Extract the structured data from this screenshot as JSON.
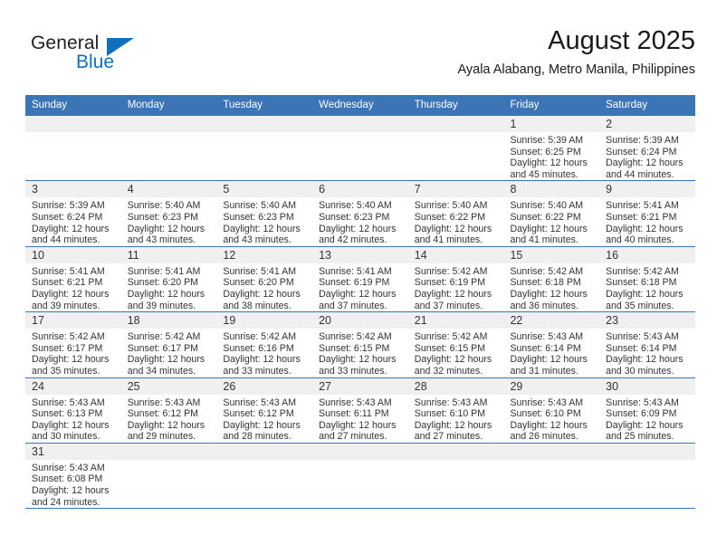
{
  "brand": {
    "name_part1": "General",
    "name_part2": "Blue",
    "logo_icon": "triangle-logo-icon",
    "accent_color": "#1070bb"
  },
  "header": {
    "month_title": "August 2025",
    "location": "Ayala Alabang, Metro Manila, Philippines"
  },
  "theme": {
    "header_blue": "#3b75b5",
    "band_gray": "#f0f0f0",
    "text_color": "#333333"
  },
  "weekday_headers": [
    "Sunday",
    "Monday",
    "Tuesday",
    "Wednesday",
    "Thursday",
    "Friday",
    "Saturday"
  ],
  "weeks": [
    [
      {
        "day": "",
        "sunrise": "",
        "sunset": "",
        "daylight1": "",
        "daylight2": ""
      },
      {
        "day": "",
        "sunrise": "",
        "sunset": "",
        "daylight1": "",
        "daylight2": ""
      },
      {
        "day": "",
        "sunrise": "",
        "sunset": "",
        "daylight1": "",
        "daylight2": ""
      },
      {
        "day": "",
        "sunrise": "",
        "sunset": "",
        "daylight1": "",
        "daylight2": ""
      },
      {
        "day": "",
        "sunrise": "",
        "sunset": "",
        "daylight1": "",
        "daylight2": ""
      },
      {
        "day": "1",
        "sunrise": "Sunrise: 5:39 AM",
        "sunset": "Sunset: 6:25 PM",
        "daylight1": "Daylight: 12 hours",
        "daylight2": "and 45 minutes."
      },
      {
        "day": "2",
        "sunrise": "Sunrise: 5:39 AM",
        "sunset": "Sunset: 6:24 PM",
        "daylight1": "Daylight: 12 hours",
        "daylight2": "and 44 minutes."
      }
    ],
    [
      {
        "day": "3",
        "sunrise": "Sunrise: 5:39 AM",
        "sunset": "Sunset: 6:24 PM",
        "daylight1": "Daylight: 12 hours",
        "daylight2": "and 44 minutes."
      },
      {
        "day": "4",
        "sunrise": "Sunrise: 5:40 AM",
        "sunset": "Sunset: 6:23 PM",
        "daylight1": "Daylight: 12 hours",
        "daylight2": "and 43 minutes."
      },
      {
        "day": "5",
        "sunrise": "Sunrise: 5:40 AM",
        "sunset": "Sunset: 6:23 PM",
        "daylight1": "Daylight: 12 hours",
        "daylight2": "and 43 minutes."
      },
      {
        "day": "6",
        "sunrise": "Sunrise: 5:40 AM",
        "sunset": "Sunset: 6:23 PM",
        "daylight1": "Daylight: 12 hours",
        "daylight2": "and 42 minutes."
      },
      {
        "day": "7",
        "sunrise": "Sunrise: 5:40 AM",
        "sunset": "Sunset: 6:22 PM",
        "daylight1": "Daylight: 12 hours",
        "daylight2": "and 41 minutes."
      },
      {
        "day": "8",
        "sunrise": "Sunrise: 5:40 AM",
        "sunset": "Sunset: 6:22 PM",
        "daylight1": "Daylight: 12 hours",
        "daylight2": "and 41 minutes."
      },
      {
        "day": "9",
        "sunrise": "Sunrise: 5:41 AM",
        "sunset": "Sunset: 6:21 PM",
        "daylight1": "Daylight: 12 hours",
        "daylight2": "and 40 minutes."
      }
    ],
    [
      {
        "day": "10",
        "sunrise": "Sunrise: 5:41 AM",
        "sunset": "Sunset: 6:21 PM",
        "daylight1": "Daylight: 12 hours",
        "daylight2": "and 39 minutes."
      },
      {
        "day": "11",
        "sunrise": "Sunrise: 5:41 AM",
        "sunset": "Sunset: 6:20 PM",
        "daylight1": "Daylight: 12 hours",
        "daylight2": "and 39 minutes."
      },
      {
        "day": "12",
        "sunrise": "Sunrise: 5:41 AM",
        "sunset": "Sunset: 6:20 PM",
        "daylight1": "Daylight: 12 hours",
        "daylight2": "and 38 minutes."
      },
      {
        "day": "13",
        "sunrise": "Sunrise: 5:41 AM",
        "sunset": "Sunset: 6:19 PM",
        "daylight1": "Daylight: 12 hours",
        "daylight2": "and 37 minutes."
      },
      {
        "day": "14",
        "sunrise": "Sunrise: 5:42 AM",
        "sunset": "Sunset: 6:19 PM",
        "daylight1": "Daylight: 12 hours",
        "daylight2": "and 37 minutes."
      },
      {
        "day": "15",
        "sunrise": "Sunrise: 5:42 AM",
        "sunset": "Sunset: 6:18 PM",
        "daylight1": "Daylight: 12 hours",
        "daylight2": "and 36 minutes."
      },
      {
        "day": "16",
        "sunrise": "Sunrise: 5:42 AM",
        "sunset": "Sunset: 6:18 PM",
        "daylight1": "Daylight: 12 hours",
        "daylight2": "and 35 minutes."
      }
    ],
    [
      {
        "day": "17",
        "sunrise": "Sunrise: 5:42 AM",
        "sunset": "Sunset: 6:17 PM",
        "daylight1": "Daylight: 12 hours",
        "daylight2": "and 35 minutes."
      },
      {
        "day": "18",
        "sunrise": "Sunrise: 5:42 AM",
        "sunset": "Sunset: 6:17 PM",
        "daylight1": "Daylight: 12 hours",
        "daylight2": "and 34 minutes."
      },
      {
        "day": "19",
        "sunrise": "Sunrise: 5:42 AM",
        "sunset": "Sunset: 6:16 PM",
        "daylight1": "Daylight: 12 hours",
        "daylight2": "and 33 minutes."
      },
      {
        "day": "20",
        "sunrise": "Sunrise: 5:42 AM",
        "sunset": "Sunset: 6:15 PM",
        "daylight1": "Daylight: 12 hours",
        "daylight2": "and 33 minutes."
      },
      {
        "day": "21",
        "sunrise": "Sunrise: 5:42 AM",
        "sunset": "Sunset: 6:15 PM",
        "daylight1": "Daylight: 12 hours",
        "daylight2": "and 32 minutes."
      },
      {
        "day": "22",
        "sunrise": "Sunrise: 5:43 AM",
        "sunset": "Sunset: 6:14 PM",
        "daylight1": "Daylight: 12 hours",
        "daylight2": "and 31 minutes."
      },
      {
        "day": "23",
        "sunrise": "Sunrise: 5:43 AM",
        "sunset": "Sunset: 6:14 PM",
        "daylight1": "Daylight: 12 hours",
        "daylight2": "and 30 minutes."
      }
    ],
    [
      {
        "day": "24",
        "sunrise": "Sunrise: 5:43 AM",
        "sunset": "Sunset: 6:13 PM",
        "daylight1": "Daylight: 12 hours",
        "daylight2": "and 30 minutes."
      },
      {
        "day": "25",
        "sunrise": "Sunrise: 5:43 AM",
        "sunset": "Sunset: 6:12 PM",
        "daylight1": "Daylight: 12 hours",
        "daylight2": "and 29 minutes."
      },
      {
        "day": "26",
        "sunrise": "Sunrise: 5:43 AM",
        "sunset": "Sunset: 6:12 PM",
        "daylight1": "Daylight: 12 hours",
        "daylight2": "and 28 minutes."
      },
      {
        "day": "27",
        "sunrise": "Sunrise: 5:43 AM",
        "sunset": "Sunset: 6:11 PM",
        "daylight1": "Daylight: 12 hours",
        "daylight2": "and 27 minutes."
      },
      {
        "day": "28",
        "sunrise": "Sunrise: 5:43 AM",
        "sunset": "Sunset: 6:10 PM",
        "daylight1": "Daylight: 12 hours",
        "daylight2": "and 27 minutes."
      },
      {
        "day": "29",
        "sunrise": "Sunrise: 5:43 AM",
        "sunset": "Sunset: 6:10 PM",
        "daylight1": "Daylight: 12 hours",
        "daylight2": "and 26 minutes."
      },
      {
        "day": "30",
        "sunrise": "Sunrise: 5:43 AM",
        "sunset": "Sunset: 6:09 PM",
        "daylight1": "Daylight: 12 hours",
        "daylight2": "and 25 minutes."
      }
    ],
    [
      {
        "day": "31",
        "sunrise": "Sunrise: 5:43 AM",
        "sunset": "Sunset: 6:08 PM",
        "daylight1": "Daylight: 12 hours",
        "daylight2": "and 24 minutes."
      },
      {
        "day": "",
        "sunrise": "",
        "sunset": "",
        "daylight1": "",
        "daylight2": ""
      },
      {
        "day": "",
        "sunrise": "",
        "sunset": "",
        "daylight1": "",
        "daylight2": ""
      },
      {
        "day": "",
        "sunrise": "",
        "sunset": "",
        "daylight1": "",
        "daylight2": ""
      },
      {
        "day": "",
        "sunrise": "",
        "sunset": "",
        "daylight1": "",
        "daylight2": ""
      },
      {
        "day": "",
        "sunrise": "",
        "sunset": "",
        "daylight1": "",
        "daylight2": ""
      },
      {
        "day": "",
        "sunrise": "",
        "sunset": "",
        "daylight1": "",
        "daylight2": ""
      }
    ]
  ]
}
